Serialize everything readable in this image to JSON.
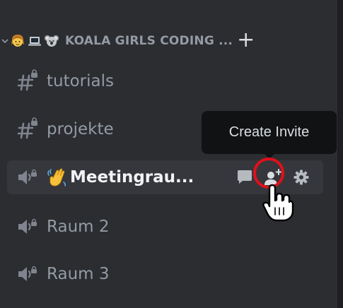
{
  "category": {
    "name": "KOALA GIRLS CODING ...",
    "add_symbol": "+"
  },
  "channels": [
    {
      "name": "tutorials",
      "type": "text",
      "active": false
    },
    {
      "name": "projekte",
      "type": "text",
      "active": false
    },
    {
      "name": "Meetingrau...",
      "type": "voice",
      "active": true
    },
    {
      "name": "Raum 2",
      "type": "voice",
      "active": false
    },
    {
      "name": "Raum 3",
      "type": "voice",
      "active": false
    }
  ],
  "tooltip": {
    "text": "Create Invite"
  },
  "icons": {
    "category_collapse": "chevron-down-icon",
    "category_emojis": [
      "girl-face-emoji-icon",
      "laptop-emoji-icon",
      "koala-emoji-icon"
    ],
    "text_channel": "hashtag-lock-icon",
    "voice_channel": "speaker-lock-icon",
    "active_channel_emoji": "waving-hand-emoji-icon",
    "actions": [
      "chat-bubble-icon",
      "add-user-icon",
      "gear-icon"
    ],
    "pointer": "hand-pointer-icon"
  },
  "colors": {
    "sidebar_background": "#2b2d31",
    "active_row_background": "#35373c",
    "muted_text": "#949ba4",
    "active_text": "#f2f3f5",
    "tooltip_background": "#111214",
    "highlight_ring": "#e0101a"
  }
}
